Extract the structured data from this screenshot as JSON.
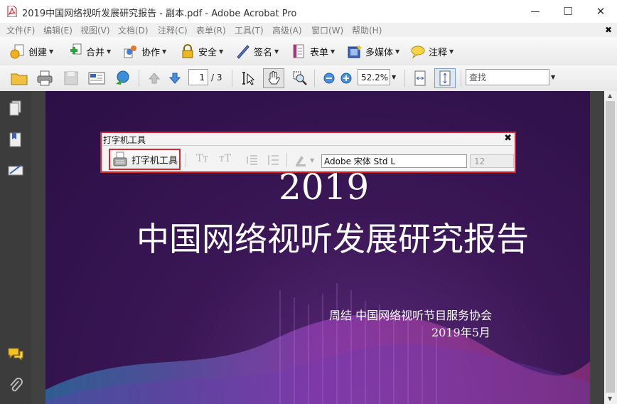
{
  "window": {
    "title": "2019中国网络视听发展研究报告 - 副本.pdf - Adobe Acrobat Pro",
    "controls": {
      "minimize": "—",
      "maximize": "☐",
      "close": "✕"
    }
  },
  "menubar": {
    "items": [
      "文件(F)",
      "编辑(E)",
      "视图(V)",
      "文档(D)",
      "注释(C)",
      "表单(R)",
      "工具(T)",
      "高级(A)",
      "窗口(W)",
      "帮助(H)"
    ],
    "close_glyph": "✖"
  },
  "toolbar1": {
    "items": [
      {
        "label": "创建",
        "icon": "create-icon"
      },
      {
        "label": "合并",
        "icon": "combine-icon"
      },
      {
        "label": "协作",
        "icon": "collaborate-icon"
      },
      {
        "label": "安全",
        "icon": "lock-icon"
      },
      {
        "label": "签名",
        "icon": "pen-icon"
      },
      {
        "label": "表单",
        "icon": "form-icon"
      },
      {
        "label": "多媒体",
        "icon": "multimedia-icon"
      },
      {
        "label": "注释",
        "icon": "comment-icon"
      }
    ]
  },
  "toolbar2": {
    "page_current": "1",
    "page_total": "/ 3",
    "zoom": "52.2%",
    "search_placeholder": "查找"
  },
  "typewriter": {
    "title": "打字机工具",
    "close": "✖",
    "tool_label": "打字机工具",
    "font_name": "Adobe 宋体 Std L",
    "font_size": "12",
    "dis_glyphs": [
      "Tт",
      "тT"
    ]
  },
  "cover": {
    "year": "2019",
    "title": "中国网络视听发展研究报告",
    "author": "周结  中国网络视听节目服务协会",
    "date": "2019年5月"
  }
}
